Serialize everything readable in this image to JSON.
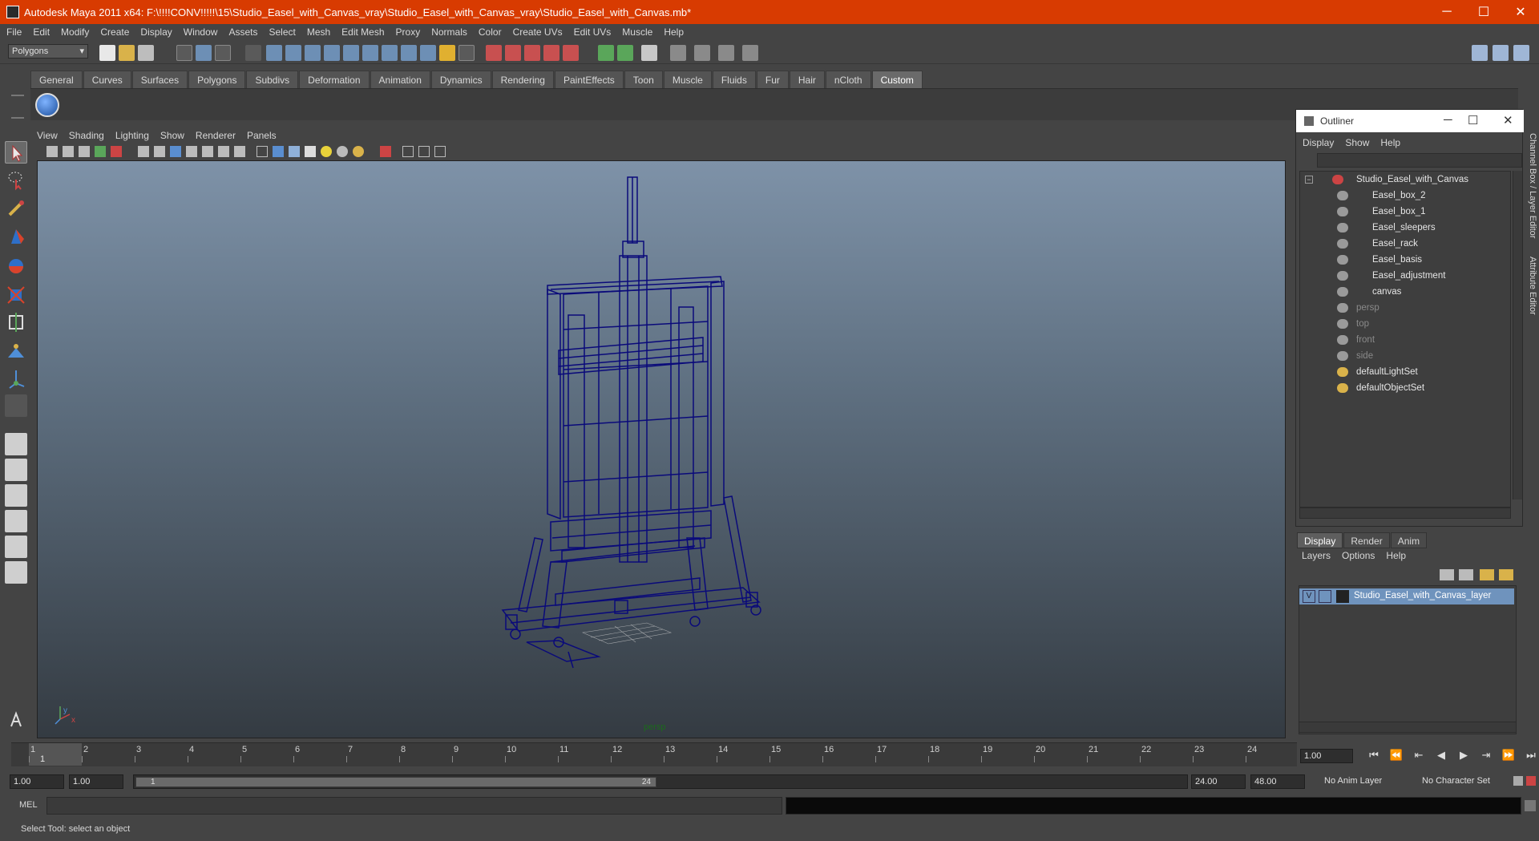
{
  "window": {
    "title": "Autodesk Maya 2011 x64: F:\\!!!!CONV!!!!!\\15\\Studio_Easel_with_Canvas_vray\\Studio_Easel_with_Canvas_vray\\Studio_Easel_with_Canvas.mb*",
    "minimize": "─",
    "maximize": "☐",
    "close": "✕"
  },
  "menubar": [
    "File",
    "Edit",
    "Modify",
    "Create",
    "Display",
    "Window",
    "Assets",
    "Select",
    "Mesh",
    "Edit Mesh",
    "Proxy",
    "Normals",
    "Color",
    "Create UVs",
    "Edit UVs",
    "Muscle",
    "Help"
  ],
  "statusline": {
    "mode": "Polygons"
  },
  "shelf": {
    "tabs": [
      "General",
      "Curves",
      "Surfaces",
      "Polygons",
      "Subdivs",
      "Deformation",
      "Animation",
      "Dynamics",
      "Rendering",
      "PaintEffects",
      "Toon",
      "Muscle",
      "Fluids",
      "Fur",
      "Hair",
      "nCloth",
      "Custom"
    ],
    "active_tab": "Custom"
  },
  "viewport": {
    "menu": [
      "View",
      "Shading",
      "Lighting",
      "Show",
      "Renderer",
      "Panels"
    ],
    "camera_label": "persp",
    "axis_x": "x",
    "axis_y": "y"
  },
  "outliner": {
    "title": "Outliner",
    "menu": [
      "Display",
      "Show",
      "Help"
    ],
    "root": "Studio_Easel_with_Canvas",
    "children": [
      "Easel_box_2",
      "Easel_box_1",
      "Easel_sleepers",
      "Easel_rack",
      "Easel_basis",
      "Easel_adjustment",
      "canvas"
    ],
    "cameras": [
      "persp",
      "top",
      "front",
      "side"
    ],
    "sets": [
      "defaultLightSet",
      "defaultObjectSet"
    ]
  },
  "side_tabs": {
    "channel_box": "Channel Box / Layer Editor",
    "attribute_editor": "Attribute Editor"
  },
  "layer_editor": {
    "tabs": [
      "Display",
      "Render",
      "Anim"
    ],
    "active_tab": "Display",
    "menu": [
      "Layers",
      "Options",
      "Help"
    ],
    "layer_visible": "V",
    "layer_name": "Studio_Easel_with_Canvas_layer"
  },
  "time_slider": {
    "ticks": [
      "1",
      "2",
      "3",
      "4",
      "5",
      "6",
      "7",
      "8",
      "9",
      "10",
      "11",
      "12",
      "13",
      "14",
      "15",
      "16",
      "17",
      "18",
      "19",
      "20",
      "21",
      "22",
      "23",
      "24"
    ],
    "current_frame": "1",
    "current_time_field": "1.00"
  },
  "range_slider": {
    "start_time": "1.00",
    "playback_start": "1.00",
    "range_start_label": "1",
    "range_end_label": "24",
    "playback_end": "24.00",
    "end_time": "48.00",
    "anim_layer": "No Anim Layer",
    "character_set": "No Character Set"
  },
  "command_line": {
    "label": "MEL"
  },
  "status": {
    "help_line": "Select Tool: select an object"
  },
  "colors": {
    "title_bar": "#d83b01",
    "wireframe": "#0a0a7a",
    "selected_layer": "#6f93bd"
  }
}
